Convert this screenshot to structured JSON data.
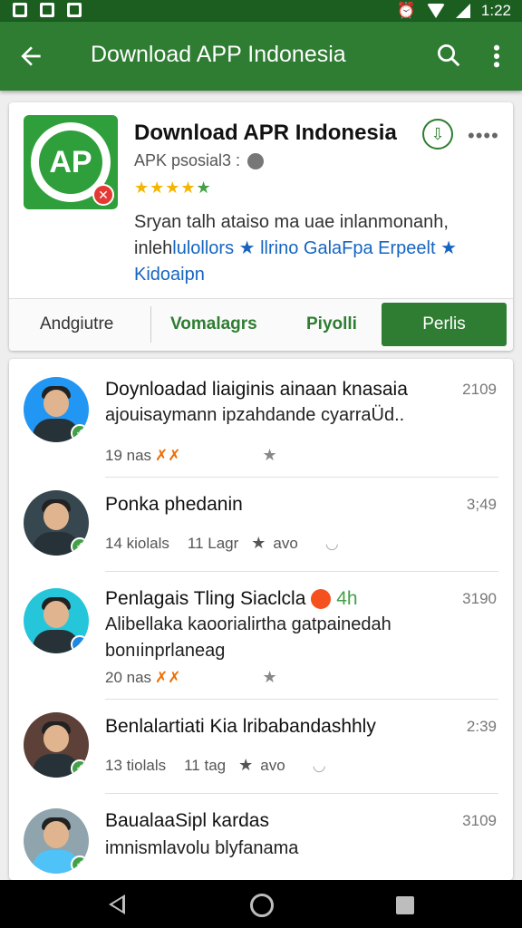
{
  "status_bar": {
    "time": "1:22"
  },
  "toolbar": {
    "title": "Download APP Indonesia"
  },
  "app": {
    "icon_text": "AP",
    "badge_text": "✕",
    "name": "Download APR Indonesia",
    "subtitle": "APK psosial3 :",
    "install_glyph": "⇩",
    "more_glyph": "••••",
    "desc_line1": "Sryan talh ataiso ma uae inlanmonanh,",
    "desc_line2_plain": "inleh",
    "desc_line2_link": "lulollors ★ llrino GalaFpa Erpeelt ★",
    "desc_line3": "Kidoaipn",
    "actions": {
      "a1": "Andgiutre",
      "a2": "Vomalagrs",
      "a3": "Piyolli",
      "a4": "Perlis"
    }
  },
  "items": [
    {
      "title": "Doynloadad liaiginis ainaan knasaia",
      "line2": "ajouisaymann ipzahdande cyarraÜd..",
      "time": "2109",
      "meta_a": "19 nas",
      "has_fire": true
    },
    {
      "title": "Ponka phedanin",
      "time": "3;49",
      "meta_a": "14 kiolals",
      "meta_b": "11 Lagr",
      "meta_c": "avo"
    },
    {
      "title": "Penlagais Tling Siaclcla",
      "title_suffix": "4h",
      "line2": "Alibellaka kaoorialirtha gatpainedah",
      "line3": "bonıinprlaneag",
      "time": "3190",
      "meta_a": "20 nas",
      "has_fire": true
    },
    {
      "title": "Benlalartiati Kia lribabandashhly",
      "time": "2:39",
      "meta_a": "13 tiolals",
      "meta_b": "11 tag",
      "meta_c": "avo"
    },
    {
      "title": "BaualaaSipl kardas",
      "line2": "imnismlavolu blyfanama",
      "time": "3109"
    }
  ]
}
